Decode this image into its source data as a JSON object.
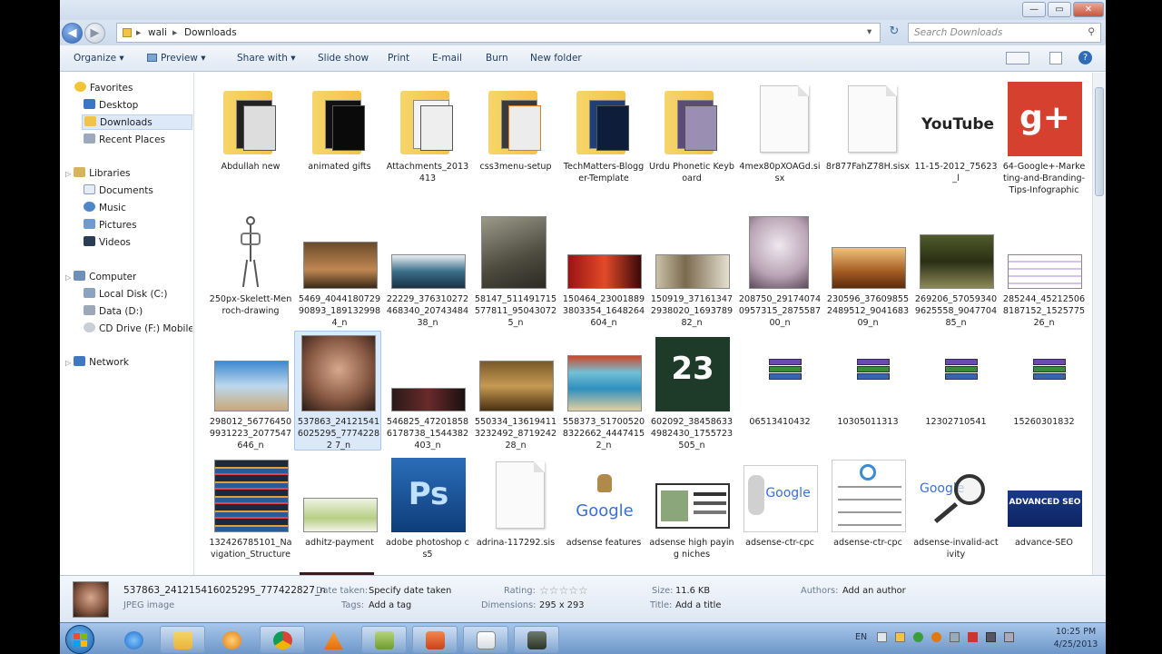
{
  "address": {
    "crumbs": [
      "wali",
      "Downloads"
    ],
    "separator": "▸"
  },
  "search": {
    "placeholder": "Search Downloads"
  },
  "window_controls": {
    "minimize": "—",
    "maximize": "▭",
    "close": "✕"
  },
  "toolbar": {
    "organize": "Organize ▾",
    "preview": "Preview ▾",
    "share": "Share with ▾",
    "slideshow": "Slide show",
    "print": "Print",
    "email": "E-mail",
    "burn": "Burn",
    "newfolder": "New folder"
  },
  "nav": {
    "favorites": "Favorites",
    "desktop": "Desktop",
    "downloads": "Downloads",
    "recent": "Recent Places",
    "libraries": "Libraries",
    "documents": "Documents",
    "music": "Music",
    "pictures": "Pictures",
    "videos": "Videos",
    "computer": "Computer",
    "localdisk": "Local Disk (C:)",
    "datad": "Data (D:)",
    "cddrive": "CD Drive (F:) Mobile I",
    "network": "Network"
  },
  "files": [
    "Abdullah new",
    "animated gifts",
    "Attachments_2013413",
    "css3menu-setup",
    "TechMatters-Blogger-Template",
    "Urdu Phonetic Keyboard",
    "4mex80pXOAGd.sisx",
    "8r877FahZ78H.sisx",
    "11-15-2012_75623_l",
    "64-Google+-Marketing-and-Branding-Tips-Infographic",
    "250px-Skelett-Menroch-drawing",
    "5469_404418072990893_1891329984_n",
    "22229_376310272468340_2074348438_n",
    "58147_511491715577811_950430725_n",
    "150464_230018893803354_1648264604_n",
    "150919_371613472938020_169378982_n",
    "208750_291740740957315_287558700_n",
    "230596_376098552489512_904168309_n",
    "269206_570593409625558_904770485_n",
    "285244_452125068187152_152577526_n",
    "298012_567764509931223_2077547646_n",
    "537863_241215416025295_77742282 7_n",
    "546825_472018586178738_1544382403_n",
    "550334_136194113232492_871924228_n",
    "558373_517005208322662_44474152_n",
    "602092_384586334982430_1755723505_n",
    "06513410432",
    "10305011313",
    "12302710541",
    "15260301832",
    "132426785101_Navigation_Structure",
    "adhitz-payment",
    "adobe photoshop cs5",
    "adrina-117292.sis",
    "adsense features",
    "adsense high paying niches",
    "adsense-ctr-cpc",
    "adsense-ctr-cpc",
    "adsense-invalid-activity",
    "advance-SEO"
  ],
  "icon_text": {
    "youtube": "YouTube",
    "gplus": "g+",
    "num23": "23",
    "google": "Google",
    "ps": "Ps",
    "seo": "ADVANCED SEO"
  },
  "details": {
    "filename": "537863_241215416025295_777422827_n",
    "filetype": "JPEG image",
    "date_key": "Date taken:",
    "date_val": "Specify date taken",
    "tags_key": "Tags:",
    "tags_val": "Add a tag",
    "rating_key": "Rating:",
    "rating_val": "☆☆☆☆☆",
    "dims_key": "Dimensions:",
    "dims_val": "295 x 293",
    "size_key": "Size:",
    "size_val": "11.6 KB",
    "title_key": "Title:",
    "title_val": "Add a title",
    "authors_key": "Authors:",
    "authors_val": "Add an author"
  },
  "taskbar": {
    "lang": "EN",
    "time": "10:25 PM",
    "date": "4/25/2013"
  }
}
